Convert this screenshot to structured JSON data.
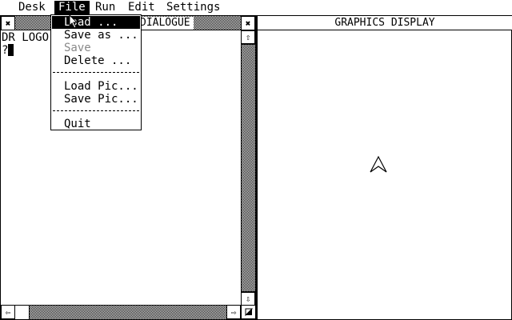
{
  "menubar": {
    "items": [
      "Desk",
      "File",
      "Run",
      "Edit",
      "Settings"
    ],
    "active": "File"
  },
  "dialogue_window": {
    "title": "DIALOGUE",
    "lines": [
      "DR LOGO",
      "?"
    ]
  },
  "graphics_window": {
    "title": "GRAPHICS DISPLAY"
  },
  "file_menu": {
    "load": "Load ...",
    "save_as": "Save as ...",
    "save": "Save",
    "delete": "Delete ...",
    "load_pic": "Load Pic...",
    "save_pic": "Save Pic...",
    "quit": "Quit"
  },
  "icons": {
    "close": "close-box-icon",
    "fuller": "fuller-box-icon",
    "up": "scroll-up-arrow-icon",
    "down": "scroll-down-arrow-icon",
    "left": "scroll-left-arrow-icon",
    "right": "scroll-right-arrow-icon",
    "size": "size-box-icon",
    "turtle": "turtle-icon",
    "pointer": "mouse-pointer-icon"
  }
}
